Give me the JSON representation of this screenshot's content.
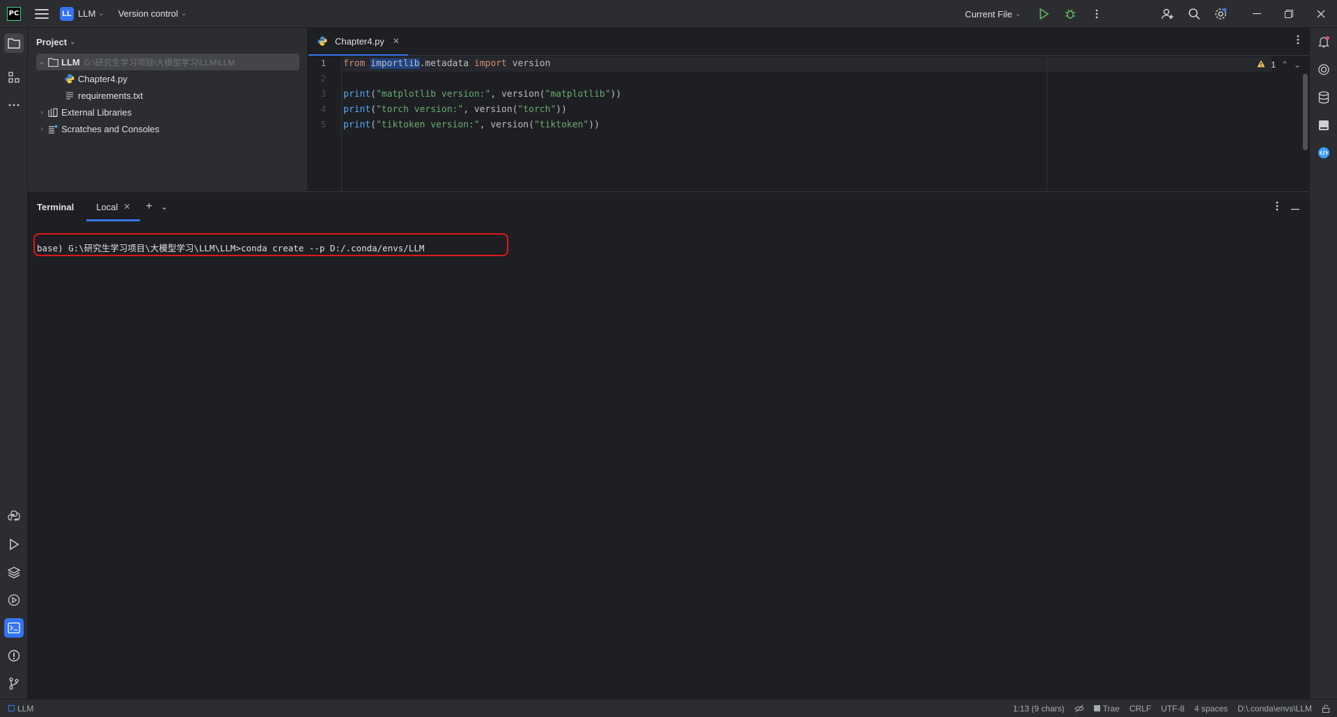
{
  "titlebar": {
    "app_logo": "PC",
    "project_badge": "LL",
    "project_name": "LLM",
    "vcs_label": "Version control",
    "run_config": "Current File"
  },
  "project_panel": {
    "header": "Project",
    "tree": [
      {
        "label": "LLM",
        "path": "G:\\研究生学习项目\\大模型学习\\LLM\\LLM"
      },
      {
        "label": "Chapter4.py"
      },
      {
        "label": "requirements.txt"
      },
      {
        "label": "External Libraries"
      },
      {
        "label": "Scratches and Consoles"
      }
    ]
  },
  "editor": {
    "tab_label": "Chapter4.py",
    "line_numbers": [
      "1",
      "2",
      "3",
      "4",
      "5"
    ],
    "warning_count": "1",
    "code": {
      "l1_from": "from",
      "l1_mod": "importlib",
      "l1_rest": ".metadata ",
      "l1_import": "import",
      "l1_name": " version",
      "l3_fn": "print",
      "l3_open": "(",
      "l3_str": "\"matplotlib version:\"",
      "l3_mid": ", version(",
      "l3_arg": "\"matplotlib\"",
      "l3_close": "))",
      "l4_fn": "print",
      "l4_open": "(",
      "l4_str": "\"torch version:\"",
      "l4_mid": ", version(",
      "l4_arg": "\"torch\"",
      "l4_close": "))",
      "l5_fn": "print",
      "l5_open": "(",
      "l5_str": "\"tiktoken version:\"",
      "l5_mid": ", version(",
      "l5_arg": "\"tiktoken\"",
      "l5_close": "))"
    }
  },
  "terminal": {
    "title": "Terminal",
    "tab_label": "Local",
    "command_line": "base) G:\\研究生学习项目\\大模型学习\\LLM\\LLM>conda create --p D:/.conda/envs/LLM"
  },
  "statusbar": {
    "project": "LLM",
    "position": "1:13 (9 chars)",
    "trae": "Trae",
    "line_sep": "CRLF",
    "encoding": "UTF-8",
    "indent": "4 spaces",
    "interpreter": "D:\\.conda\\envs\\LLM"
  },
  "colors": {
    "accent": "#3574f0",
    "highlight_box": "#e01818",
    "run_green": "#5fb865"
  },
  "icons": [
    "hamburger-icon",
    "run-icon",
    "debug-icon",
    "more-vert-icon",
    "add-user-icon",
    "search-icon",
    "settings-icon",
    "minimize-icon",
    "restore-icon",
    "close-icon",
    "folder-icon",
    "structure-icon",
    "more-horiz-icon",
    "python-console-icon",
    "run-tool-icon",
    "layers-icon",
    "services-icon",
    "terminal-icon",
    "problems-icon",
    "git-icon",
    "notifications-icon",
    "ai-assistant-icon",
    "database-icon",
    "bookmark-icon",
    "chat-icon",
    "python-file-icon",
    "text-file-icon",
    "library-icon",
    "scratches-icon",
    "warning-icon",
    "lock-icon"
  ]
}
